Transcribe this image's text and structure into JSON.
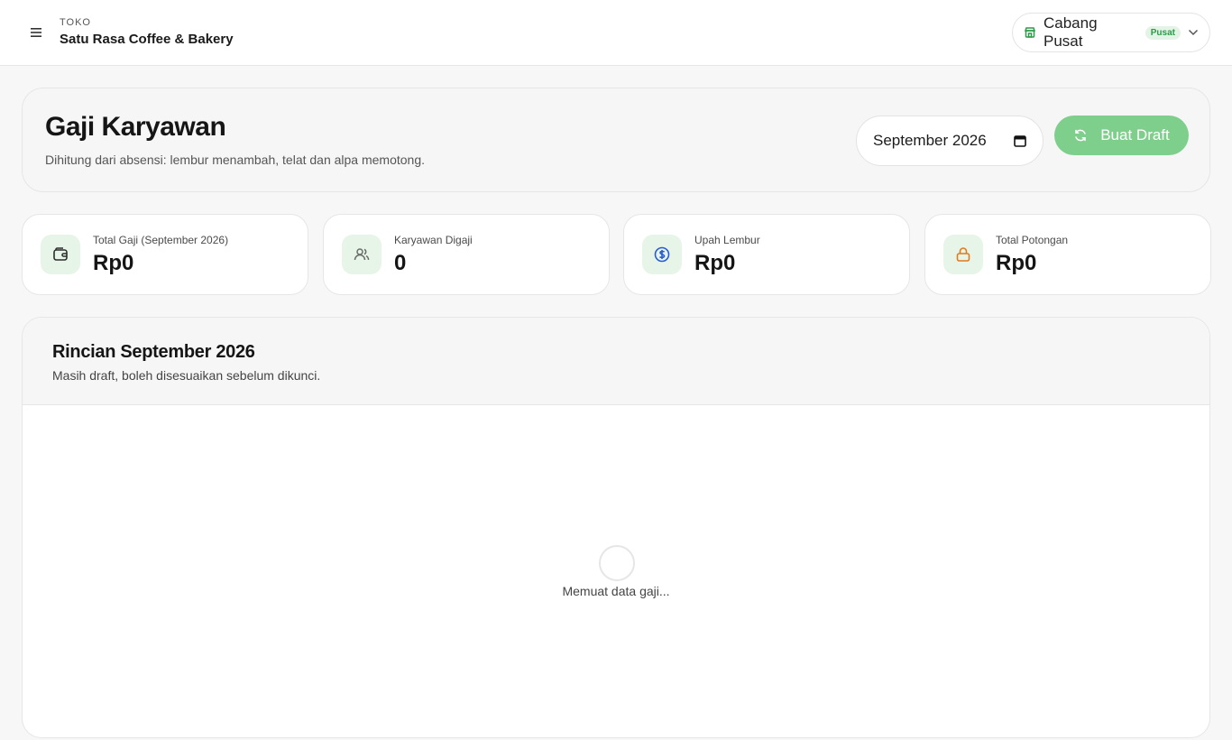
{
  "topbar": {
    "store_kicker": "TOKO",
    "store_name": "Satu Rasa Coffee & Bakery",
    "branch": {
      "label": "Cabang Pusat",
      "badge": "Pusat"
    }
  },
  "header": {
    "title": "Gaji Karyawan",
    "subtitle": "Dihitung dari absensi: lembur menambah, telat dan alpa memotong.",
    "month_value": "September 2026",
    "draft_button": "Buat Draft"
  },
  "stats": [
    {
      "label": "Total Gaji (September 2026)",
      "value": "Rp0",
      "icon": "wallet-icon",
      "color": "#2d2d2d"
    },
    {
      "label": "Karyawan Digaji",
      "value": "0",
      "icon": "users-icon",
      "color": "#6b6b6b"
    },
    {
      "label": "Upah Lembur",
      "value": "Rp0",
      "icon": "dollar-circle-icon",
      "color": "#2a5bd7"
    },
    {
      "label": "Total Potongan",
      "value": "Rp0",
      "icon": "lock-icon",
      "color": "#e07a1f"
    }
  ],
  "details": {
    "title": "Rincian September 2026",
    "subtitle": "Masih draft, boleh disesuaikan sebelum dikunci.",
    "loading_text": "Memuat data gaji..."
  },
  "colors": {
    "accent": "#7fcf8c",
    "icon_bg": "#e6f5e8",
    "badge_green": "#2c9a48"
  }
}
